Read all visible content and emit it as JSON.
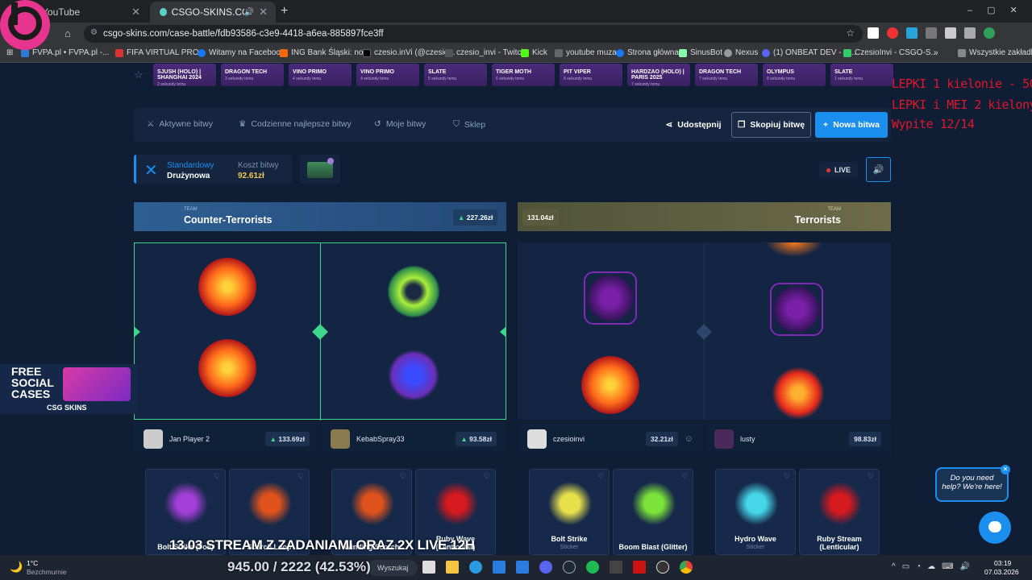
{
  "browser": {
    "tabs": [
      {
        "title": "YouTube"
      },
      {
        "title": "CSGO-SKINS.COM - Najlep"
      }
    ],
    "url": "csgo-skins.com/case-battle/fdb93586-c3e9-4418-a6ea-885897fce3ff",
    "bookmarks": [
      "FVPA.pl • FVPA.pl -...",
      "FIFA VIRTUAL PRO...",
      "Witamy na Faceboo...",
      "ING Bank Śląski: no...",
      "czesio.inVi (@czesio...",
      "czesio_invi - Twitch",
      "Kick",
      "youtube muza",
      "Strona główna",
      "SinusBot",
      "Nexus",
      "(1) ONBEAT DEV - D...",
      "CzesioInvi - CSGO-S...",
      "»",
      "Wszystkie zakładki"
    ]
  },
  "ticker": [
    {
      "name": "SJUSH (HOLO) | SHANGHAI 2024",
      "time": "2 sekundy temu"
    },
    {
      "name": "DRAGON TECH",
      "time": "3 sekundy temu"
    },
    {
      "name": "VINO PRIMO",
      "time": "4 sekundy temu"
    },
    {
      "name": "VINO PRIMO",
      "time": "4 sekundy temu"
    },
    {
      "name": "SLATE",
      "time": "5 sekundy temu"
    },
    {
      "name": "TIGER MOTH",
      "time": "6 sekundy temu"
    },
    {
      "name": "PIT VIPER",
      "time": "6 sekundy temu"
    },
    {
      "name": "HARDZAO (HOLO) | PARIS 2025",
      "time": "7 sekundy temu"
    },
    {
      "name": "DRAGON TECH",
      "time": "7 sekundy temu"
    },
    {
      "name": "OLYMPUS",
      "time": "8 sekundy temu"
    },
    {
      "name": "SLATE",
      "time": "1 sekundy temu"
    }
  ],
  "nav": {
    "items": [
      "Aktywne bitwy",
      "Codzienne najlepsze bitwy",
      "Moje bitwy",
      "Sklep"
    ],
    "share": "Udostępnij",
    "copy": "Skopiuj bitwę",
    "new": "Nowa bitwa"
  },
  "battle": {
    "mode": "Standardowy",
    "mode_sub": "Drużynowa",
    "cost_label": "Koszt bitwy",
    "cost": "92.61zł",
    "live": "LIVE"
  },
  "teams": {
    "ct": {
      "label": "TEAM",
      "name": "Counter-Terrorists",
      "total": "227.26zł"
    },
    "t": {
      "label": "TEAM",
      "name": "Terrorists",
      "total": "131.04zł"
    }
  },
  "players": [
    {
      "name": "Jan Player 2",
      "amount": "133.69zł"
    },
    {
      "name": "KebabSpray33",
      "amount": "93.58zł"
    },
    {
      "name": "czesioinvi",
      "amount": "32.21zł"
    },
    {
      "name": "lusty",
      "amount": "98.83zł"
    }
  ],
  "cards": [
    {
      "name": "Bolt Strike (Foil)",
      "sub": ""
    },
    {
      "name": "Scorch Loop",
      "sub": ""
    },
    {
      "name": "Winding Scorch",
      "sub": ""
    },
    {
      "name": "Ruby Wave (Lenticular)",
      "sub": ""
    },
    {
      "name": "Bolt Strike",
      "sub": "Sticker"
    },
    {
      "name": "Boom Blast (Glitter)",
      "sub": ""
    },
    {
      "name": "Hydro Wave",
      "sub": "Sticker"
    },
    {
      "name": "Ruby Stream (Lenticular)",
      "sub": ""
    }
  ],
  "promo": {
    "line1": "FREE",
    "line2": "SOCIAL",
    "line3": "CASES",
    "brand": "CSG SKINS"
  },
  "help": "Do you need help? We're here!",
  "overlay": {
    "red1": "LEPKI 1 kielonie - 50zl",
    "red2": "LEPKI i MEI 2 kielony - 100zl",
    "red3": "Wypite 12/14",
    "stream": "13.03 STREAM Z ZADANIAMI ORAZ 2X LIVE 12H",
    "progress": "945.00 / 2222 (42.53%)"
  },
  "taskbar": {
    "temp": "1°C",
    "weather": "Bezchmurnie",
    "search": "Wyszukaj",
    "time": "03:19",
    "date": "07.03.2026"
  },
  "colors": {
    "accent": "#1a8ff0",
    "ct": "#3a6aa0",
    "t": "#8a8658",
    "green": "#3dd68c"
  }
}
